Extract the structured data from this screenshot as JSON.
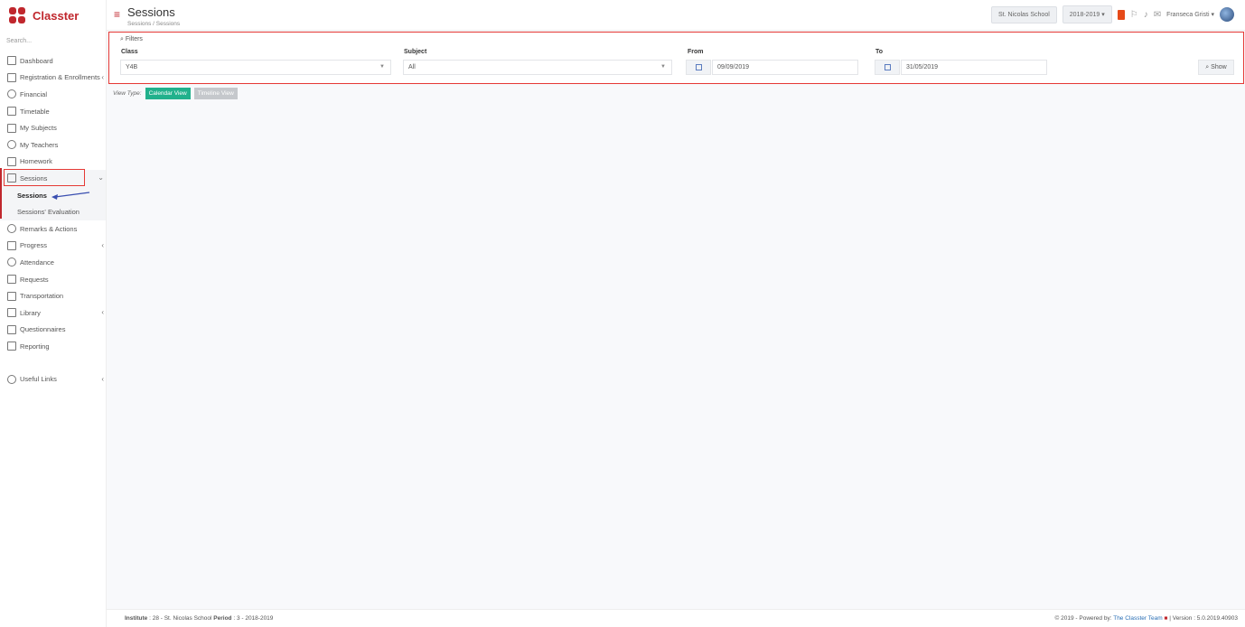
{
  "app": {
    "name": "Classter"
  },
  "sidebar": {
    "search_placeholder": "Search...",
    "items": [
      {
        "label": "Dashboard"
      },
      {
        "label": "Registration & Enrollments"
      },
      {
        "label": "Financial"
      },
      {
        "label": "Timetable"
      },
      {
        "label": "My Subjects"
      },
      {
        "label": "My Teachers"
      },
      {
        "label": "Homework"
      },
      {
        "label": "Sessions"
      },
      {
        "label": "Sessions"
      },
      {
        "label": "Sessions' Evaluation"
      },
      {
        "label": "Remarks & Actions"
      },
      {
        "label": "Progress"
      },
      {
        "label": "Attendance"
      },
      {
        "label": "Requests"
      },
      {
        "label": "Transportation"
      },
      {
        "label": "Library"
      },
      {
        "label": "Questionnaires"
      },
      {
        "label": "Reporting"
      },
      {
        "label": "Useful Links"
      }
    ]
  },
  "header": {
    "title": "Sessions",
    "breadcrumb": "Sessions / Sessions",
    "school": "St. Nicolas School",
    "year": "2018-2019 ▾",
    "user": "Franseca Gristi ▾"
  },
  "filters": {
    "title": "Filters",
    "class_label": "Class",
    "class_value": "Y4B",
    "subject_label": "Subject",
    "subject_value": "All",
    "from_label": "From",
    "from_value": "09/09/2019",
    "to_label": "To",
    "to_value": "31/05/2019",
    "show_label": "Show"
  },
  "view": {
    "label": "View Type:",
    "calendar": "Calendar View",
    "timeline": "Timeline View"
  },
  "footer": {
    "left_inst_label": "Institute",
    "left_inst_value": ": 28 - St. Nicolas School",
    "left_period_label": "Period",
    "left_period_value": ": 3 - 2018-2019",
    "right_prefix": "© 2019 - Powered by:",
    "right_link": "The Classter Team",
    "right_version": "| Version : 5.0.2019.40903"
  },
  "colors": {
    "accent": "#c0272d",
    "primary_btn": "#21b18c",
    "highlight": "#e53935"
  }
}
